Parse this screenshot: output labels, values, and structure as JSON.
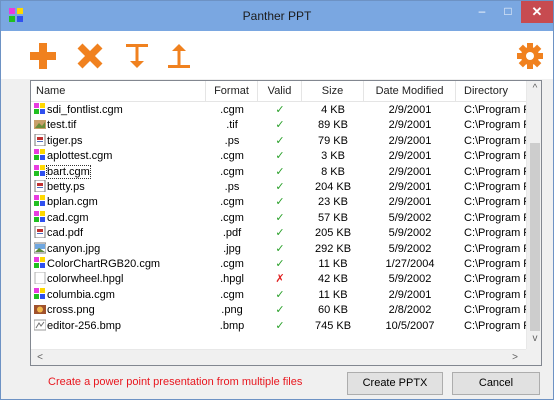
{
  "window": {
    "title": "Panther PPT",
    "minimize": "–",
    "maximize": "□",
    "close": "✕"
  },
  "toolbar": {
    "add": {
      "icon": "plus-icon",
      "color": "#f0811f"
    },
    "remove": {
      "icon": "x-icon",
      "color": "#f0811f"
    },
    "move_down": {
      "icon": "arrow-down-to-line-icon",
      "color": "#f0811f"
    },
    "move_up": {
      "icon": "arrow-up-from-line-icon",
      "color": "#f0811f"
    },
    "settings": {
      "icon": "gear-icon",
      "color": "#f0811f"
    }
  },
  "table": {
    "columns": [
      "Name",
      "Format",
      "Valid",
      "Size",
      "Date Modified",
      "Directory"
    ],
    "rows": [
      {
        "name": "sdi_fontlist.cgm",
        "icon": "cgm-file-icon",
        "format": ".cgm",
        "valid": "✓",
        "size": "4 KB",
        "date": "2/9/2001",
        "dir": "C:\\Program F"
      },
      {
        "name": "test.tif",
        "icon": "tif-file-icon",
        "format": ".tif",
        "valid": "✓",
        "size": "89 KB",
        "date": "2/9/2001",
        "dir": "C:\\Program F"
      },
      {
        "name": "tiger.ps",
        "icon": "ps-file-icon",
        "format": ".ps",
        "valid": "✓",
        "size": "79 KB",
        "date": "2/9/2001",
        "dir": "C:\\Program F"
      },
      {
        "name": "aplottest.cgm",
        "icon": "cgm-file-icon",
        "format": ".cgm",
        "valid": "✓",
        "size": "3 KB",
        "date": "2/9/2001",
        "dir": "C:\\Program F"
      },
      {
        "name": "bart.cgm",
        "icon": "cgm-file-icon",
        "format": ".cgm",
        "valid": "✓",
        "size": "8 KB",
        "date": "2/9/2001",
        "dir": "C:\\Program F"
      },
      {
        "name": "betty.ps",
        "icon": "ps-file-icon",
        "format": ".ps",
        "valid": "✓",
        "size": "204 KB",
        "date": "2/9/2001",
        "dir": "C:\\Program F"
      },
      {
        "name": "bplan.cgm",
        "icon": "cgm-file-icon",
        "format": ".cgm",
        "valid": "✓",
        "size": "23 KB",
        "date": "2/9/2001",
        "dir": "C:\\Program F"
      },
      {
        "name": "cad.cgm",
        "icon": "cgm-file-icon",
        "format": ".cgm",
        "valid": "✓",
        "size": "57 KB",
        "date": "5/9/2002",
        "dir": "C:\\Program F"
      },
      {
        "name": "cad.pdf",
        "icon": "pdf-file-icon",
        "format": ".pdf",
        "valid": "✓",
        "size": "205 KB",
        "date": "5/9/2002",
        "dir": "C:\\Program F"
      },
      {
        "name": "canyon.jpg",
        "icon": "jpg-file-icon",
        "format": ".jpg",
        "valid": "✓",
        "size": "292 KB",
        "date": "5/9/2002",
        "dir": "C:\\Program F"
      },
      {
        "name": "ColorChartRGB20.cgm",
        "icon": "cgm-file-icon",
        "format": ".cgm",
        "valid": "✓",
        "size": "11 KB",
        "date": "1/27/2004",
        "dir": "C:\\Program F"
      },
      {
        "name": "colorwheel.hpgl",
        "icon": "hpgl-file-icon",
        "format": ".hpgl",
        "valid": "✗",
        "size": "42 KB",
        "date": "5/9/2002",
        "dir": "C:\\Program F"
      },
      {
        "name": "columbia.cgm",
        "icon": "cgm-file-icon",
        "format": ".cgm",
        "valid": "✓",
        "size": "11 KB",
        "date": "2/9/2001",
        "dir": "C:\\Program F"
      },
      {
        "name": "cross.png",
        "icon": "png-file-icon",
        "format": ".png",
        "valid": "✓",
        "size": "60 KB",
        "date": "2/8/2002",
        "dir": "C:\\Program F"
      },
      {
        "name": "editor-256.bmp",
        "icon": "bmp-file-icon",
        "format": ".bmp",
        "valid": "✓",
        "size": "745 KB",
        "date": "10/5/2007",
        "dir": "C:\\Program F"
      }
    ]
  },
  "scroll": {
    "up": "^",
    "down": "v",
    "left": "<",
    "right": ">"
  },
  "footer": {
    "message": "Create a power point presentation from multiple files",
    "create_label": "Create PPTX",
    "cancel_label": "Cancel"
  }
}
